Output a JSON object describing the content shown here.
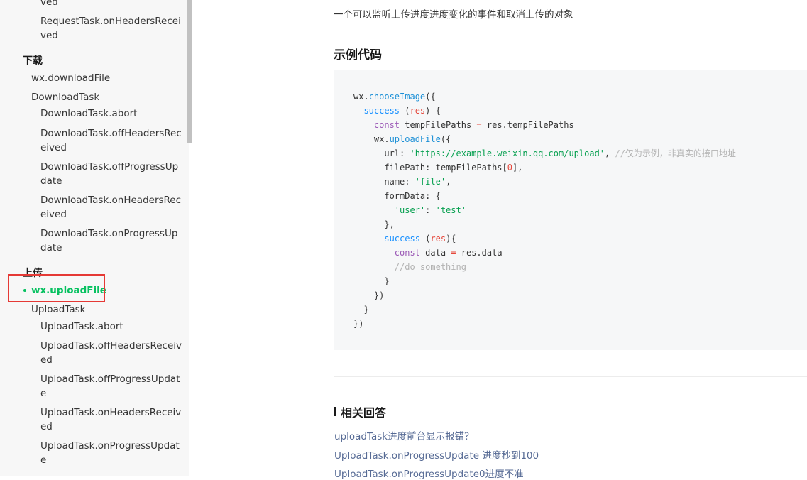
{
  "sidebar": {
    "top_items": [
      {
        "text": "ved",
        "level": 2
      },
      {
        "text": "RequestTask.onHeadersRecei",
        "level": 2
      },
      {
        "text": "ved",
        "level": 2
      }
    ],
    "download_header": "下载",
    "download_items": [
      {
        "text": "wx.downloadFile",
        "level": 1
      },
      {
        "text": "DownloadTask",
        "level": 1
      },
      {
        "text": "DownloadTask.abort",
        "level": 2
      },
      {
        "text": "DownloadTask.offHeadersRec",
        "level": 2
      },
      {
        "text": "eived",
        "level": 2
      },
      {
        "text": "DownloadTask.offProgressUp",
        "level": 2
      },
      {
        "text": "date",
        "level": 2
      },
      {
        "text": "DownloadTask.onHeadersRec",
        "level": 2
      },
      {
        "text": "eived",
        "level": 2
      },
      {
        "text": "DownloadTask.onProgressUp",
        "level": 2
      },
      {
        "text": "date",
        "level": 2
      }
    ],
    "upload_header": "上传",
    "active_item": "wx.uploadFile",
    "upload_items": [
      {
        "text": "UploadTask",
        "level": 1
      },
      {
        "text": "UploadTask.abort",
        "level": 2
      },
      {
        "text": "UploadTask.offHeadersReceiv",
        "level": 2
      },
      {
        "text": "ed",
        "level": 2
      },
      {
        "text": "UploadTask.offProgressUpdat",
        "level": 2
      },
      {
        "text": "e",
        "level": 2
      },
      {
        "text": "UploadTask.onHeadersReceiv",
        "level": 2
      },
      {
        "text": "ed",
        "level": 2
      },
      {
        "text": "UploadTask.onProgressUpdat",
        "level": 2
      },
      {
        "text": "e",
        "level": 2
      }
    ]
  },
  "main": {
    "intro": "一个可以监听上传进度进度变化的事件和取消上传的对象",
    "example_heading": "示例代码",
    "code_comment_1": "//仅为示例，非真实的接口地址",
    "code_comment_2": "//do something",
    "code_url": "'https://example.weixin.qq.com/upload'",
    "related_heading": "相关回答",
    "related_links": [
      "uploadTask进度前台显示报错？",
      "UploadTask.onProgressUpdate 进度秒到100",
      "UploadTask.onProgressUpdate0进度不准"
    ]
  },
  "colors": {
    "accent": "#07c160",
    "link": "#576b95",
    "highlight_border": "#e53935"
  }
}
